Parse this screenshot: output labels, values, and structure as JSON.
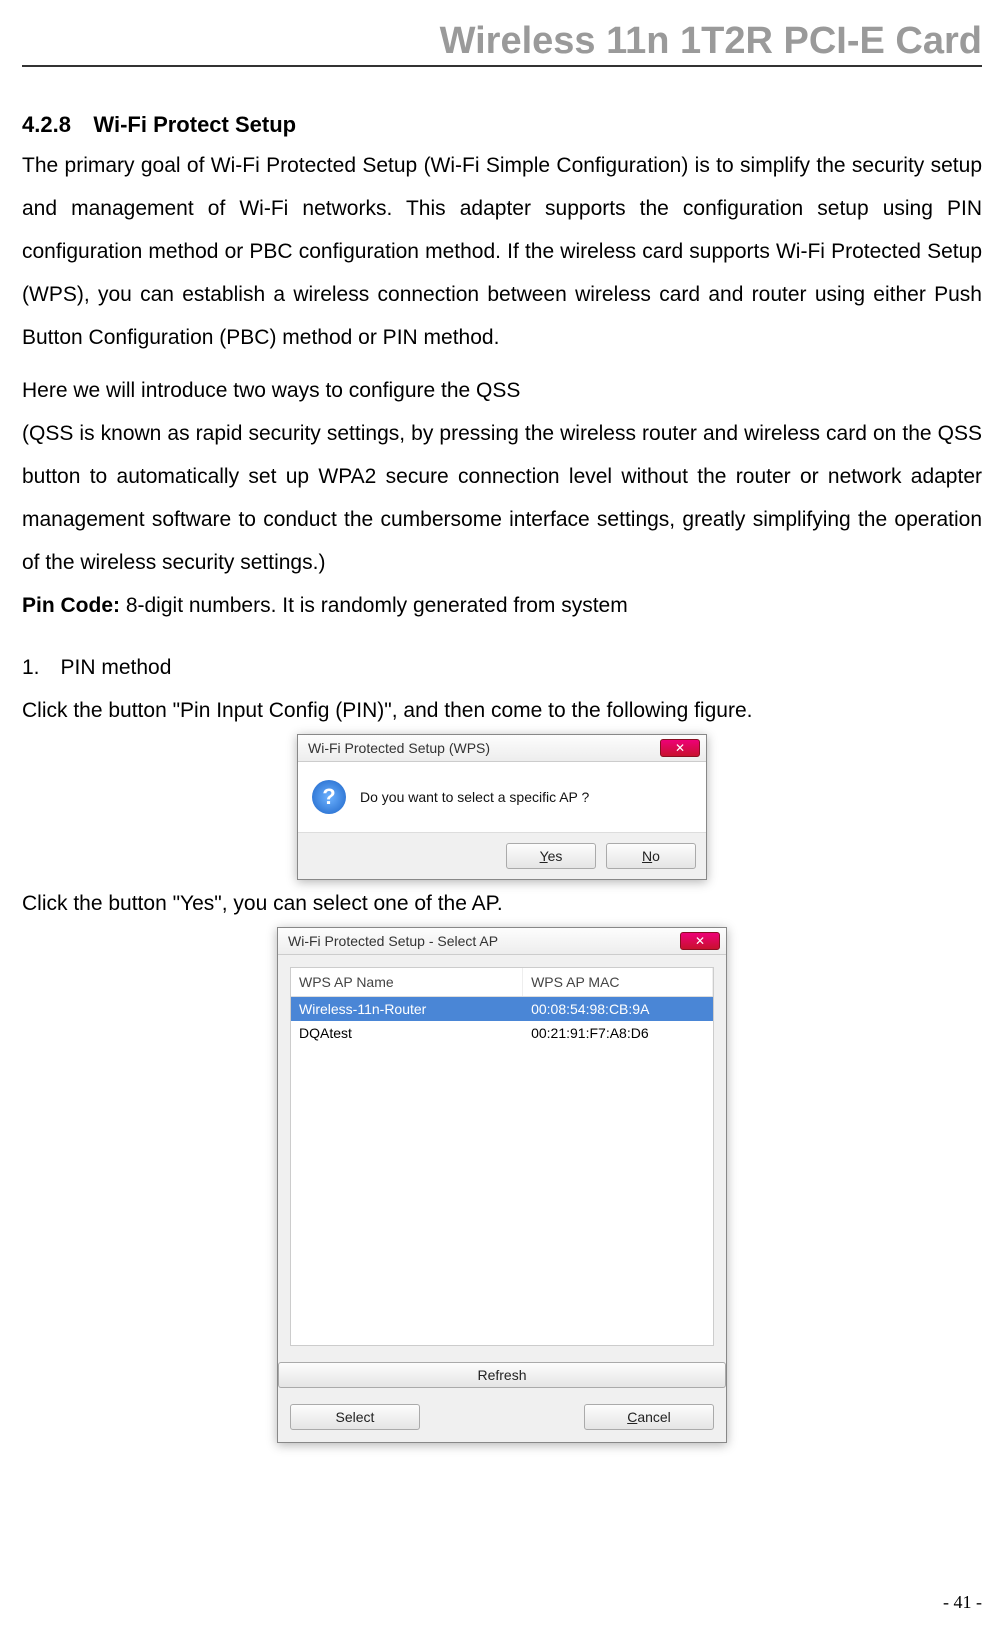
{
  "header": {
    "title": "Wireless 11n 1T2R PCI-E Card"
  },
  "section": {
    "num": "4.2.8",
    "heading": "Wi-Fi Protect Setup",
    "p1": "The primary goal of Wi-Fi Protected Setup (Wi-Fi Simple Configuration) is to simplify the security setup and management of Wi-Fi networks. This adapter supports the configuration setup using PIN configuration method or PBC configuration method. If the wireless card supports Wi-Fi Protected Setup (WPS), you can establish a wireless connection between wireless card and router using either Push Button Configuration (PBC) method or PIN method.",
    "p2a": "Here we will introduce two ways to configure the QSS",
    "p2b": "(QSS is known as rapid security settings, by pressing the wireless router and wireless card on the QSS button to automatically set up WPA2 secure connection level without the router or network adapter management software to conduct the cumbersome interface settings, greatly simplifying the operation of the wireless security settings.)",
    "pincode_label": "Pin Code:",
    "pincode_text": " 8-digit numbers. It is randomly generated from system",
    "list_item": "1. PIN method",
    "caption1": "Click the button \"Pin Input Config (PIN)\", and then come to the following figure.",
    "caption2": "Click the button \"Yes\", you can select one of the AP."
  },
  "dialog1": {
    "title": "Wi-Fi Protected Setup (WPS)",
    "message": "Do you want to select a specific AP ?",
    "yes_u": "Y",
    "yes_rest": "es",
    "no_u": "N",
    "no_rest": "o"
  },
  "dialog2": {
    "title": "Wi-Fi Protected Setup - Select AP",
    "col_name": "WPS AP Name",
    "col_mac": "WPS AP MAC",
    "rows": [
      {
        "name": "Wireless-11n-Router",
        "mac": "00:08:54:98:CB:9A"
      },
      {
        "name": "DQAtest",
        "mac": "00:21:91:F7:A8:D6"
      }
    ],
    "refresh": "Refresh",
    "select": "Select",
    "cancel_u": "C",
    "cancel_rest": "ancel"
  },
  "footer": {
    "page": "- 41 -"
  }
}
